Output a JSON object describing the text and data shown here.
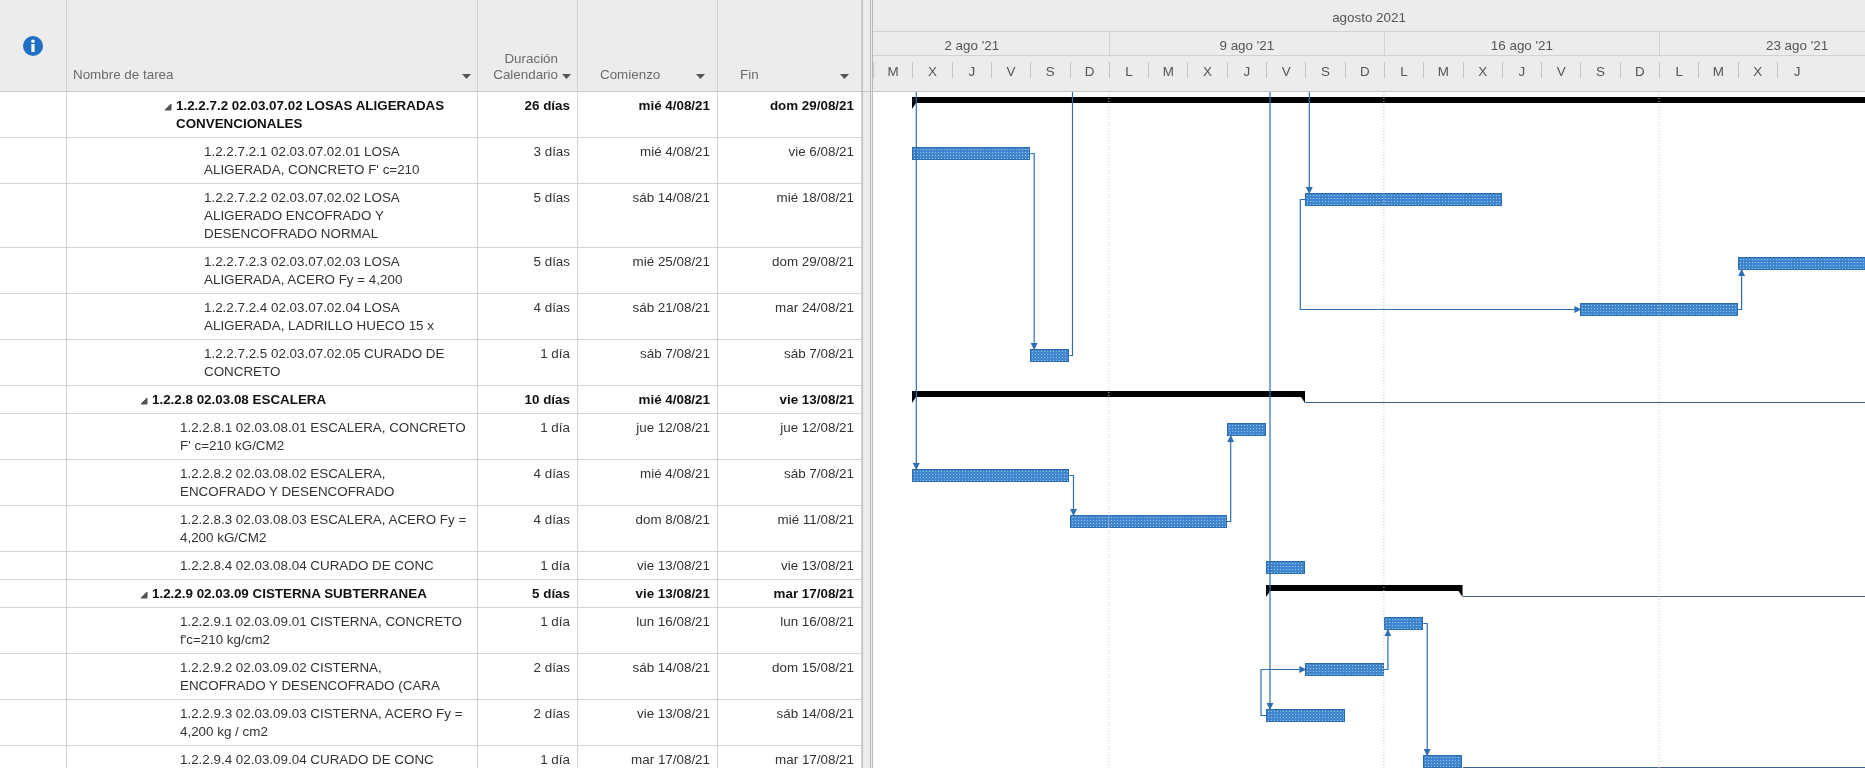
{
  "columns": [
    {
      "label": "Nombre de tarea"
    },
    {
      "label": "Duración Calendario"
    },
    {
      "label": "Comienzo"
    },
    {
      "label": "Fin"
    }
  ],
  "timescale": {
    "month": "agosto 2021",
    "weeks": [
      "2 ago '21",
      "9 ago '21",
      "16 ago '21",
      "23 ago '21"
    ],
    "days": [
      "M",
      "X",
      "J",
      "V",
      "S",
      "D",
      "L",
      "M",
      "X",
      "J",
      "V",
      "S",
      "D",
      "L",
      "M",
      "X",
      "J",
      "V",
      "S",
      "D",
      "L",
      "M",
      "X",
      "J"
    ]
  },
  "tasks": [
    {
      "children": [
        {
          "kind": "summary",
          "expanded": true,
          "name": "1.2.2.7.2 02.03.07.02 LOSAS ALIGERADAS CONVENCIONALES",
          "duration": "26 días",
          "start": "mié 4/08/21",
          "finish": "dom 29/08/21",
          "children": [
            {
              "kind": "task",
              "name": "1.2.2.7.2.1 02.03.07.02.01 LOSA ALIGERADA, CONCRETO F' c=210",
              "duration": "3 días",
              "start": "mié 4/08/21",
              "finish": "vie 6/08/21"
            },
            {
              "kind": "task",
              "name": "1.2.2.7.2.2 02.03.07.02.02 LOSA ALIGERADO ENCOFRADO Y DESENCOFRADO NORMAL",
              "duration": "5 días",
              "start": "sáb 14/08/21",
              "finish": "mié 18/08/21"
            },
            {
              "kind": "task",
              "name": "1.2.2.7.2.3 02.03.07.02.03 LOSA ALIGERADA, ACERO Fy = 4,200",
              "duration": "5 días",
              "start": "mié 25/08/21",
              "finish": "dom 29/08/21"
            },
            {
              "kind": "task",
              "name": "1.2.2.7.2.4 02.03.07.02.04 LOSA ALIGERADA, LADRILLO HUECO 15 x",
              "duration": "4 días",
              "start": "sáb 21/08/21",
              "finish": "mar 24/08/21"
            },
            {
              "kind": "task",
              "name": "1.2.2.7.2.5 02.03.07.02.05 CURADO DE CONCRETO",
              "duration": "1 día",
              "start": "sáb 7/08/21",
              "finish": "sáb 7/08/21"
            }
          ]
        }
      ]
    },
    {
      "kind": "summary",
      "expanded": true,
      "name": "1.2.2.8 02.03.08 ESCALERA",
      "duration": "10 días",
      "start": "mié 4/08/21",
      "finish": "vie 13/08/21",
      "trailing_line": true,
      "children": [
        {
          "kind": "task",
          "name": "1.2.2.8.1 02.03.08.01 ESCALERA, CONCRETO F' c=210 kG/CM2",
          "duration": "1 día",
          "start": "jue 12/08/21",
          "finish": "jue 12/08/21"
        },
        {
          "kind": "task",
          "name": "1.2.2.8.2 02.03.08.02 ESCALERA, ENCOFRADO Y DESENCOFRADO",
          "duration": "4 días",
          "start": "mié 4/08/21",
          "finish": "sáb 7/08/21"
        },
        {
          "kind": "task",
          "name": "1.2.2.8.3 02.03.08.03 ESCALERA, ACERO Fy = 4,200 kG/CM2",
          "duration": "4 días",
          "start": "dom 8/08/21",
          "finish": "mié 11/08/21"
        },
        {
          "kind": "task",
          "name": "1.2.2.8.4 02.03.08.04 CURADO DE CONC",
          "duration": "1 día",
          "start": "vie 13/08/21",
          "finish": "vie 13/08/21"
        }
      ]
    },
    {
      "kind": "summary",
      "expanded": true,
      "name": "1.2.2.9 02.03.09 CISTERNA SUBTERRANEA",
      "duration": "5 días",
      "start": "vie 13/08/21",
      "finish": "mar 17/08/21",
      "trailing_line": true,
      "children": [
        {
          "kind": "task",
          "name": "1.2.2.9.1 02.03.09.01 CISTERNA, CONCRETO  f'c=210 kg/cm2",
          "duration": "1 día",
          "start": "lun 16/08/21",
          "finish": "lun 16/08/21"
        },
        {
          "kind": "task",
          "name": "1.2.2.9.2 02.03.09.02 CISTERNA, ENCOFRADO Y DESENCOFRADO (CARA",
          "duration": "2 días",
          "start": "sáb 14/08/21",
          "finish": "dom 15/08/21"
        },
        {
          "kind": "task",
          "name": "1.2.2.9.3 02.03.09.03 CISTERNA, ACERO Fy = 4,200 kg / cm2",
          "duration": "2 días",
          "start": "vie 13/08/21",
          "finish": "sáb 14/08/21"
        },
        {
          "kind": "task",
          "name": "1.2.2.9.4 02.03.09.04 CURADO DE CONC",
          "duration": "1 día",
          "start": "mar 17/08/21",
          "finish": "mar 17/08/21",
          "trailing_line": true
        }
      ]
    }
  ]
}
